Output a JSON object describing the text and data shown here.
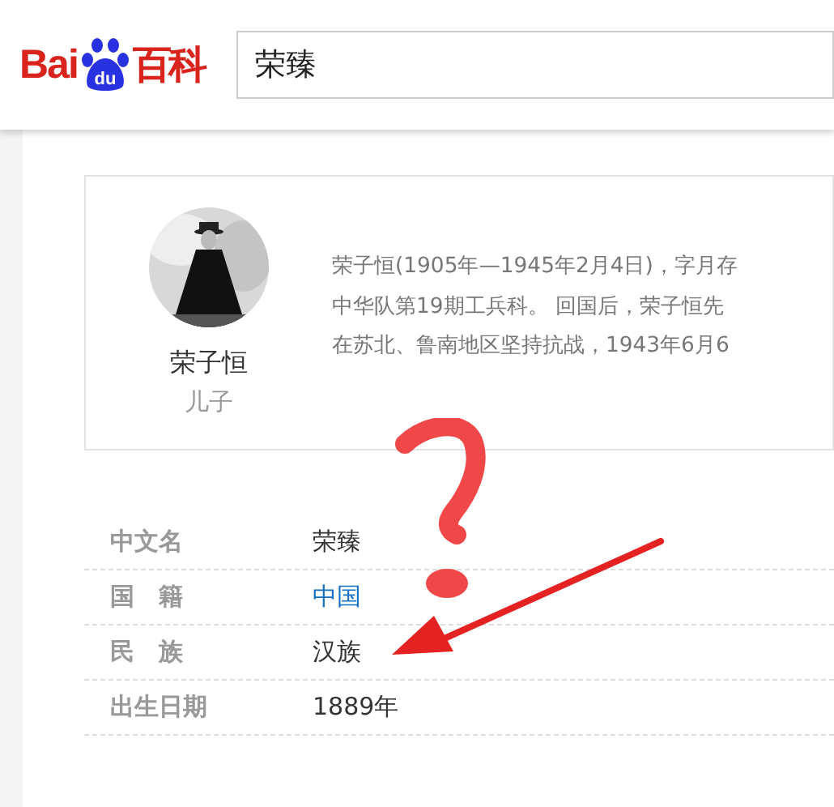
{
  "header": {
    "logo": {
      "latin": "Bai",
      "paw": "du",
      "chinese": "百科"
    },
    "search": {
      "value": "荣臻"
    }
  },
  "relation": {
    "photo": {
      "kind": "picture"
    },
    "name": "荣子恒",
    "relation": "儿子",
    "summary_lines": [
      "荣子恒(1905年—1945年2月4日)，字月存",
      "中华队第19期工兵科。 回国后，荣子恒先",
      "在苏北、鲁南地区坚持抗战，1943年6月6"
    ]
  },
  "info": [
    {
      "label": "中文名",
      "value": "荣臻",
      "link": false
    },
    {
      "label": "国　籍",
      "value": "中国",
      "link": true
    },
    {
      "label": "民　族",
      "value": "汉族",
      "link": false
    },
    {
      "label": "出生日期",
      "value": "1889年",
      "link": false
    }
  ],
  "annotations": [
    {
      "kind": "question-mark"
    },
    {
      "kind": "arrow"
    }
  ]
}
